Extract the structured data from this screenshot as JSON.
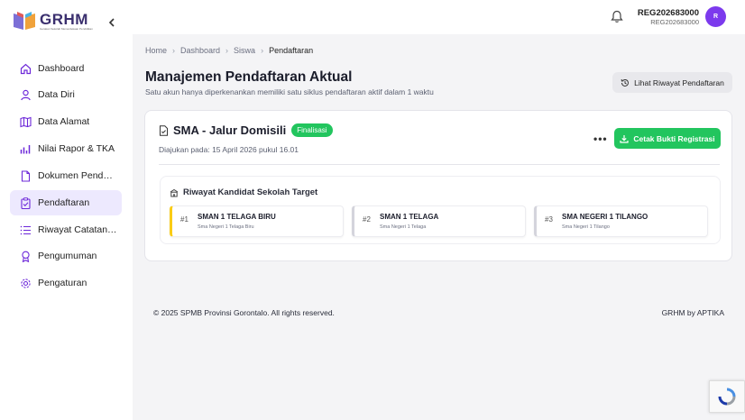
{
  "brand": {
    "title": "GRHM",
    "subtitle": "Gerakan Sekolah Memerdekaan Pendidikan"
  },
  "user": {
    "name": "REG202683000",
    "sub": "REG202683000",
    "avatar_initial": "R",
    "avatar_color": "#7c3aed"
  },
  "sidebar": {
    "items": [
      {
        "label": "Dashboard",
        "icon": "home-icon"
      },
      {
        "label": "Data Diri",
        "icon": "user-icon"
      },
      {
        "label": "Data Alamat",
        "icon": "map-icon"
      },
      {
        "label": "Nilai Rapor & TKA",
        "icon": "chart-icon"
      },
      {
        "label": "Dokumen Pendaftaran",
        "icon": "document-icon"
      },
      {
        "label": "Pendaftaran",
        "icon": "clipboard-icon",
        "active": true
      },
      {
        "label": "Riwayat Catatan Data",
        "icon": "list-icon"
      },
      {
        "label": "Pengumuman",
        "icon": "award-icon"
      },
      {
        "label": "Pengaturan",
        "icon": "gear-icon"
      }
    ]
  },
  "breadcrumb": [
    "Home",
    "Dashboard",
    "Siswa",
    "Pendaftaran"
  ],
  "page": {
    "title": "Manajemen Pendaftaran Aktual",
    "description": "Satu akun hanya diperkenankan memiliki satu siklus pendaftaran aktif dalam 1 waktu",
    "history_button": "Lihat Riwayat Pendaftaran"
  },
  "registration": {
    "title": "SMA - Jalur Domisili",
    "status": "Finalisasi",
    "status_color": "#22c55e",
    "submitted": "Diajukan pada: 15 April 2026 pukul 16.01",
    "more": "•••",
    "print_button": "Cetak Bukti Registrasi"
  },
  "candidates": {
    "title": "Riwayat Kandidat Sekolah Target",
    "schools": [
      {
        "num": "#1",
        "name": "SMAN 1 TELAGA BIRU",
        "sub": "Sma Negeri 1 Telaga Biru"
      },
      {
        "num": "#2",
        "name": "SMAN 1 TELAGA",
        "sub": "Sma Negeri 1 Telaga"
      },
      {
        "num": "#3",
        "name": "SMA NEGERI 1 TILANGO",
        "sub": "Sma Negeri 1 Tilango"
      }
    ]
  },
  "footer": {
    "left": "© 2025 SPMB Provinsi Gorontalo. All rights reserved.",
    "right": "GRHM by APTIKA"
  }
}
